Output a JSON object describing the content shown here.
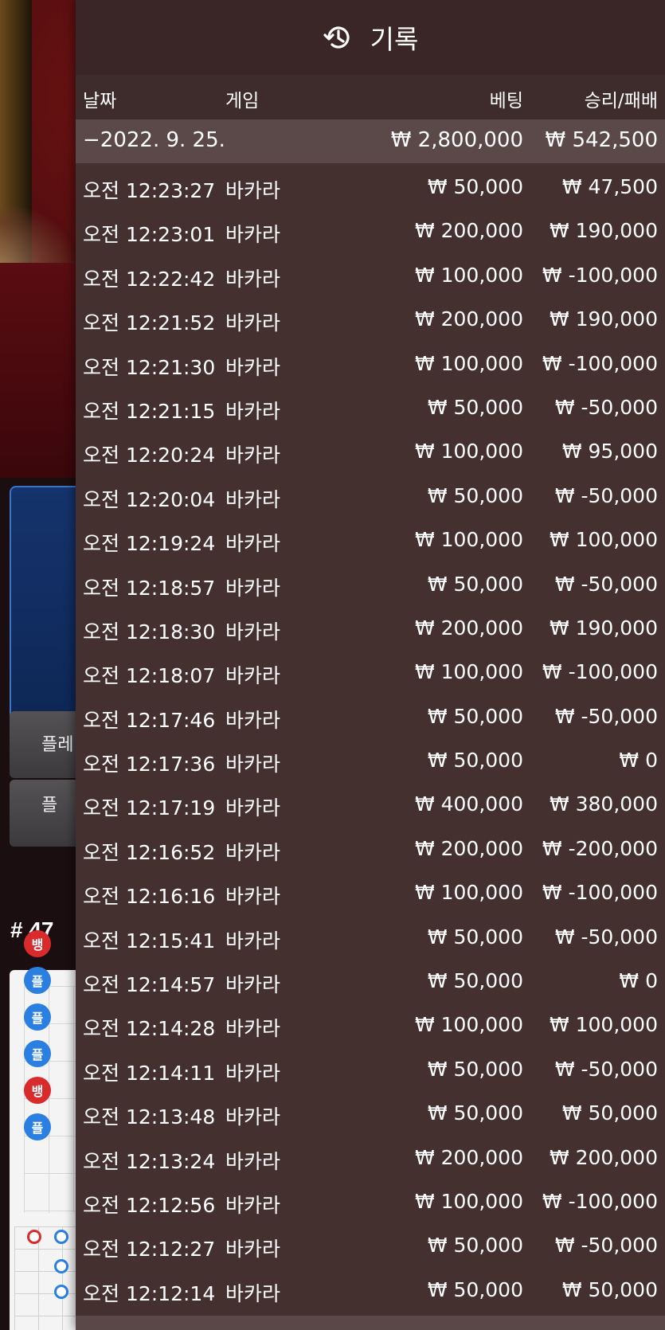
{
  "background": {
    "bet_panel_label": "플",
    "side_button_1": "플레",
    "side_button_2": "플",
    "round_number": "# 47",
    "road_marks": [
      {
        "type": "b",
        "label": "뱅"
      },
      {
        "type": "p",
        "label": "플"
      },
      {
        "type": "p",
        "label": "플"
      },
      {
        "type": "p",
        "label": "플"
      },
      {
        "type": "b",
        "label": "뱅"
      },
      {
        "type": "p",
        "label": "플"
      }
    ]
  },
  "history": {
    "title": "기록",
    "icon": "history-clock-icon",
    "columns": {
      "date": "날짜",
      "game": "게임",
      "bet": "베팅",
      "result": "승리/패배"
    },
    "summary": {
      "date": "−2022. 9. 25.",
      "bet": "₩ 2,800,000",
      "result": "₩ 542,500"
    },
    "rows": [
      {
        "time": "오전 12:23:27",
        "game": "바카라",
        "bet": "₩ 50,000",
        "result": "₩ 47,500"
      },
      {
        "time": "오전 12:23:01",
        "game": "바카라",
        "bet": "₩ 200,000",
        "result": "₩ 190,000"
      },
      {
        "time": "오전 12:22:42",
        "game": "바카라",
        "bet": "₩ 100,000",
        "result": "₩ -100,000"
      },
      {
        "time": "오전 12:21:52",
        "game": "바카라",
        "bet": "₩ 200,000",
        "result": "₩ 190,000"
      },
      {
        "time": "오전 12:21:30",
        "game": "바카라",
        "bet": "₩ 100,000",
        "result": "₩ -100,000"
      },
      {
        "time": "오전 12:21:15",
        "game": "바카라",
        "bet": "₩ 50,000",
        "result": "₩ -50,000"
      },
      {
        "time": "오전 12:20:24",
        "game": "바카라",
        "bet": "₩ 100,000",
        "result": "₩ 95,000"
      },
      {
        "time": "오전 12:20:04",
        "game": "바카라",
        "bet": "₩ 50,000",
        "result": "₩ -50,000"
      },
      {
        "time": "오전 12:19:24",
        "game": "바카라",
        "bet": "₩ 100,000",
        "result": "₩ 100,000"
      },
      {
        "time": "오전 12:18:57",
        "game": "바카라",
        "bet": "₩ 50,000",
        "result": "₩ -50,000"
      },
      {
        "time": "오전 12:18:30",
        "game": "바카라",
        "bet": "₩ 200,000",
        "result": "₩ 190,000"
      },
      {
        "time": "오전 12:18:07",
        "game": "바카라",
        "bet": "₩ 100,000",
        "result": "₩ -100,000"
      },
      {
        "time": "오전 12:17:46",
        "game": "바카라",
        "bet": "₩ 50,000",
        "result": "₩ -50,000"
      },
      {
        "time": "오전 12:17:36",
        "game": "바카라",
        "bet": "₩ 50,000",
        "result": "₩ 0"
      },
      {
        "time": "오전 12:17:19",
        "game": "바카라",
        "bet": "₩ 400,000",
        "result": "₩ 380,000"
      },
      {
        "time": "오전 12:16:52",
        "game": "바카라",
        "bet": "₩ 200,000",
        "result": "₩ -200,000"
      },
      {
        "time": "오전 12:16:16",
        "game": "바카라",
        "bet": "₩ 100,000",
        "result": "₩ -100,000"
      },
      {
        "time": "오전 12:15:41",
        "game": "바카라",
        "bet": "₩ 50,000",
        "result": "₩ -50,000"
      },
      {
        "time": "오전 12:14:57",
        "game": "바카라",
        "bet": "₩ 50,000",
        "result": "₩ 0"
      },
      {
        "time": "오전 12:14:28",
        "game": "바카라",
        "bet": "₩ 100,000",
        "result": "₩ 100,000"
      },
      {
        "time": "오전 12:14:11",
        "game": "바카라",
        "bet": "₩ 50,000",
        "result": "₩ -50,000"
      },
      {
        "time": "오전 12:13:48",
        "game": "바카라",
        "bet": "₩ 50,000",
        "result": "₩ 50,000"
      },
      {
        "time": "오전 12:13:24",
        "game": "바카라",
        "bet": "₩ 200,000",
        "result": "₩ 200,000"
      },
      {
        "time": "오전 12:12:56",
        "game": "바카라",
        "bet": "₩ 100,000",
        "result": "₩ -100,000"
      },
      {
        "time": "오전 12:12:27",
        "game": "바카라",
        "bet": "₩ 50,000",
        "result": "₩ -50,000"
      },
      {
        "time": "오전 12:12:14",
        "game": "바카라",
        "bet": "₩ 50,000",
        "result": "₩ 50,000"
      }
    ]
  }
}
